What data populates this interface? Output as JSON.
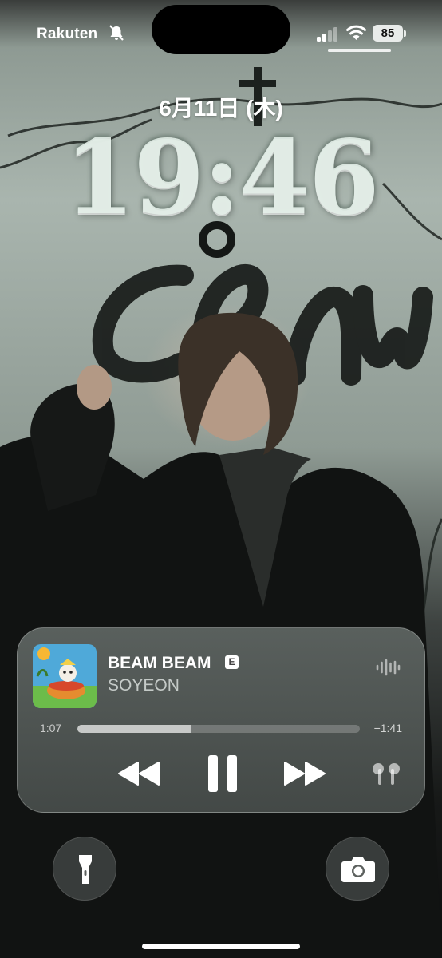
{
  "status_bar": {
    "carrier": "Rakuten",
    "mute_icon": "bell-slash-icon",
    "signal_icon": "cellular-signal-icon",
    "wifi_icon": "wifi-icon",
    "battery_level": "85"
  },
  "lock_screen": {
    "date": "6月11日 (木)",
    "time": "19:46"
  },
  "now_playing": {
    "title": "BEAM BEAM",
    "explicit_badge": "E",
    "artist": "SOYEON",
    "elapsed": "1:07",
    "remaining": "−1:41",
    "progress_fraction": 0.4,
    "icons": {
      "waveform": "waveform-icon",
      "rewind": "backward-icon",
      "pause": "pause-icon",
      "forward": "forward-icon",
      "output": "airpods-icon"
    }
  },
  "quick_actions": {
    "left": "flashlight-icon",
    "right": "camera-icon"
  },
  "colors": {
    "text": "#ffffff",
    "player_glass": "#8c9691"
  }
}
